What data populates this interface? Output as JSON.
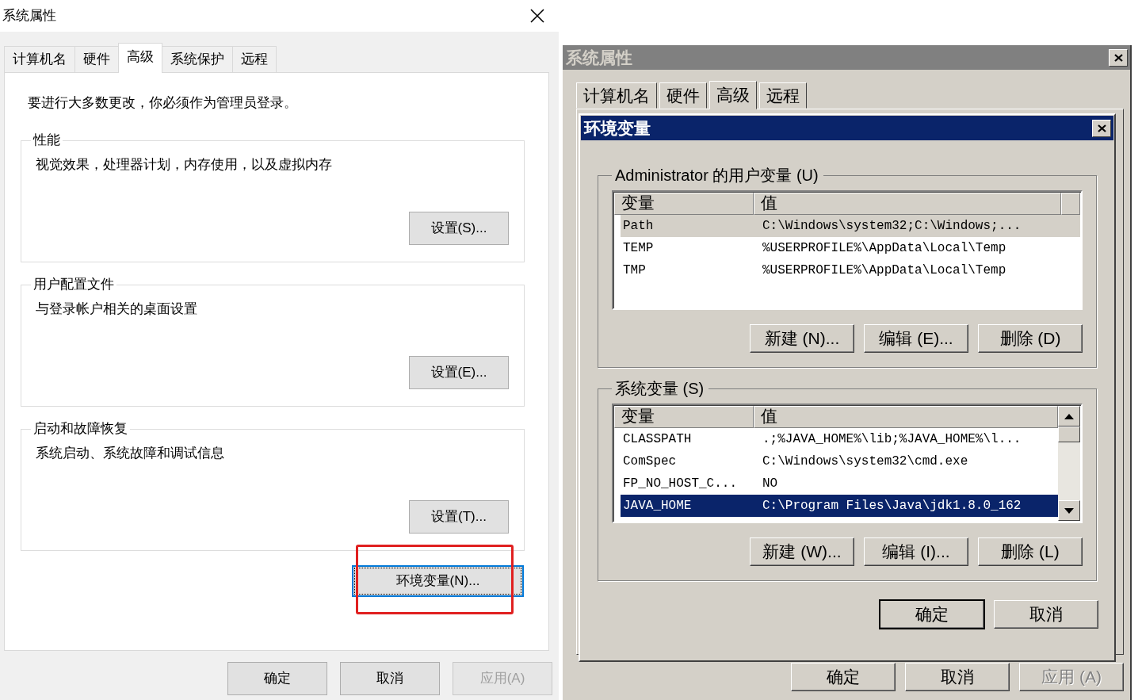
{
  "left_window": {
    "title": "系统属性",
    "tabs": [
      {
        "label": "计算机名",
        "selected": false
      },
      {
        "label": "硬件",
        "selected": false
      },
      {
        "label": "高级",
        "selected": true
      },
      {
        "label": "系统保护",
        "selected": false
      },
      {
        "label": "远程",
        "selected": false
      }
    ],
    "notice": "要进行大多数更改，你必须作为管理员登录。",
    "groups": [
      {
        "title": "性能",
        "description": "视觉效果，处理器计划，内存使用，以及虚拟内存",
        "button": "设置(S)..."
      },
      {
        "title": "用户配置文件",
        "description": "与登录帐户相关的桌面设置",
        "button": "设置(E)..."
      },
      {
        "title": "启动和故障恢复",
        "description": "系统启动、系统故障和调试信息",
        "button": "设置(T)..."
      }
    ],
    "env_button": {
      "label": "环境变量(N)...",
      "focused": true,
      "highlighted": true
    },
    "buttons": [
      {
        "label": "确定",
        "disabled": false
      },
      {
        "label": "取消",
        "disabled": false
      },
      {
        "label": "应用(A)",
        "disabled": true
      }
    ]
  },
  "right_window": {
    "title": "系统属性",
    "active": false,
    "tabs": [
      {
        "label": "计算机名",
        "selected": false
      },
      {
        "label": "硬件",
        "selected": false
      },
      {
        "label": "高级",
        "selected": true
      },
      {
        "label": "远程",
        "selected": false
      }
    ],
    "buttons": [
      {
        "label": "确定",
        "disabled": false
      },
      {
        "label": "取消",
        "disabled": false
      },
      {
        "label": "应用 (A)",
        "disabled": true
      }
    ]
  },
  "env_dialog": {
    "title": "环境变量",
    "active": true,
    "sections": [
      {
        "title": "Administrator 的用户变量 (U)",
        "columns": [
          "变量",
          "值"
        ],
        "focused": false,
        "scrollbar": false,
        "rows": [
          {
            "name": "Path",
            "value": "C:\\Windows\\system32;C:\\Windows;...",
            "selected": true
          },
          {
            "name": "TEMP",
            "value": "%USERPROFILE%\\AppData\\Local\\Temp",
            "selected": false
          },
          {
            "name": "TMP",
            "value": "%USERPROFILE%\\AppData\\Local\\Temp",
            "selected": false
          }
        ],
        "buttons": [
          "新建 (N)...",
          "编辑 (E)...",
          "删除 (D)"
        ]
      },
      {
        "title": "系统变量 (S)",
        "columns": [
          "变量",
          "值"
        ],
        "focused": true,
        "scrollbar": true,
        "rows": [
          {
            "name": "CLASSPATH",
            "value": ".;%JAVA_HOME%\\lib;%JAVA_HOME%\\l...",
            "selected": false
          },
          {
            "name": "ComSpec",
            "value": "C:\\Windows\\system32\\cmd.exe",
            "selected": false
          },
          {
            "name": "FP_NO_HOST_C...",
            "value": "NO",
            "selected": false
          },
          {
            "name": "JAVA_HOME",
            "value": "C:\\Program Files\\Java\\jdk1.8.0_162",
            "selected": true
          }
        ],
        "buttons": [
          "新建 (W)...",
          "编辑 (I)...",
          "删除 (L)"
        ]
      }
    ],
    "buttons": [
      {
        "label": "确定",
        "default": true
      },
      {
        "label": "取消",
        "default": false
      }
    ]
  }
}
